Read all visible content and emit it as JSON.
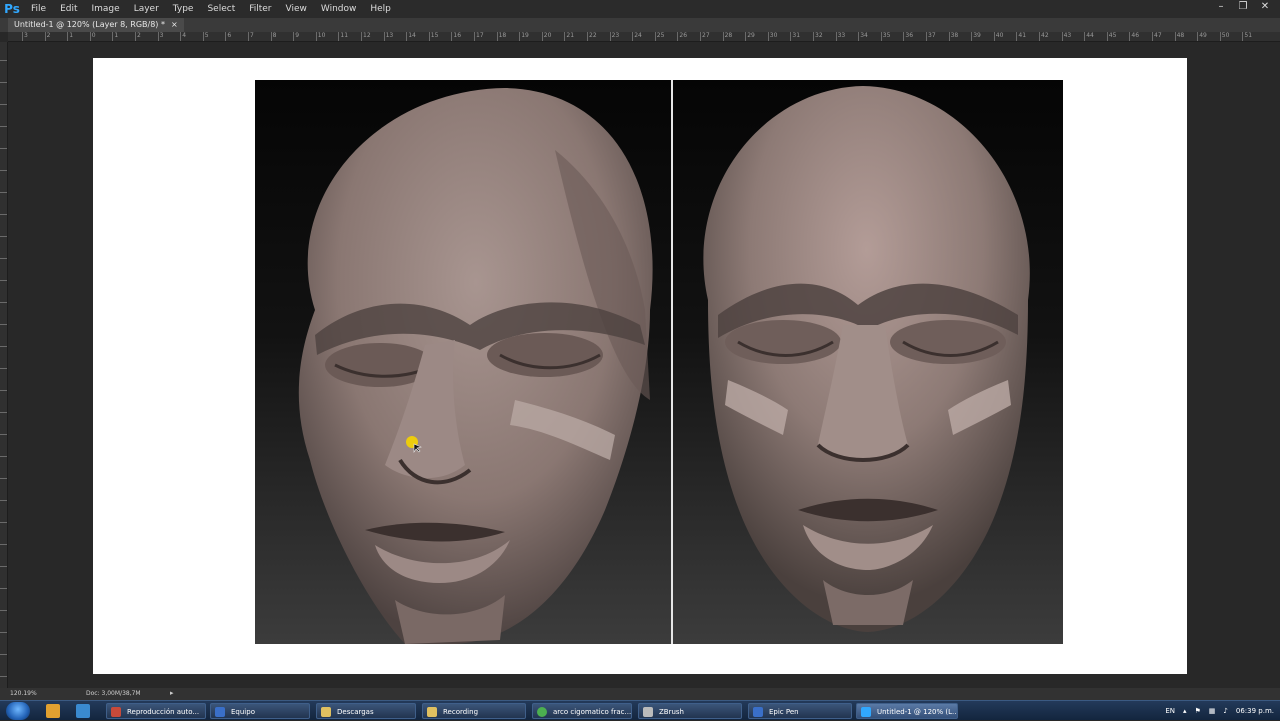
{
  "app": {
    "logo": "Ps"
  },
  "menu": [
    "File",
    "Edit",
    "Image",
    "Layer",
    "Type",
    "Select",
    "Filter",
    "View",
    "Window",
    "Help"
  ],
  "window_controls": [
    "–",
    "❐",
    "✕"
  ],
  "document_tab": {
    "title": "Untitled-1 @ 120% (Layer 8, RGB/8) *",
    "close": "×"
  },
  "ruler": {
    "labels": [
      "3",
      "2",
      "1",
      "0",
      "1",
      "2",
      "3",
      "4",
      "5",
      "6",
      "7",
      "8",
      "9",
      "10",
      "11",
      "12",
      "13",
      "14",
      "15",
      "16",
      "17",
      "18",
      "19",
      "20",
      "21",
      "22",
      "23",
      "24",
      "25",
      "26",
      "27",
      "28",
      "29",
      "30",
      "31",
      "32",
      "33",
      "34",
      "35",
      "36",
      "37",
      "38",
      "39",
      "40",
      "41",
      "42",
      "43",
      "44",
      "45",
      "46",
      "47",
      "48",
      "49",
      "50",
      "51"
    ]
  },
  "status": {
    "zoom": "120.19%",
    "doc": "Doc: 3,00M/38,7M",
    "arrow": "▸"
  },
  "taskbar": {
    "items": [
      {
        "label": "Reproducción auto...",
        "icon_color": "#c84a3a",
        "active": false
      },
      {
        "label": "Equipo",
        "icon_color": "#3a6fc8",
        "active": false
      },
      {
        "label": "Descargas",
        "icon_color": "#e0c060",
        "active": false
      },
      {
        "label": "Recording",
        "icon_color": "#e0c060",
        "active": false
      },
      {
        "label": "arco cigomatico frac...",
        "icon_color": "#4caf50",
        "active": false
      },
      {
        "label": "ZBrush",
        "icon_color": "#bbbbbb",
        "active": false
      },
      {
        "label": "Epic Pen",
        "icon_color": "#3a6fc8",
        "active": false
      },
      {
        "label": "Untitled-1 @ 120% (L...",
        "icon_color": "#31a8ff",
        "active": true
      }
    ],
    "tray": {
      "lang": "EN",
      "time": "06:39 p.m."
    }
  },
  "colors": {
    "ps_blue": "#31a8ff",
    "cursor_yellow": "#f5d400"
  }
}
